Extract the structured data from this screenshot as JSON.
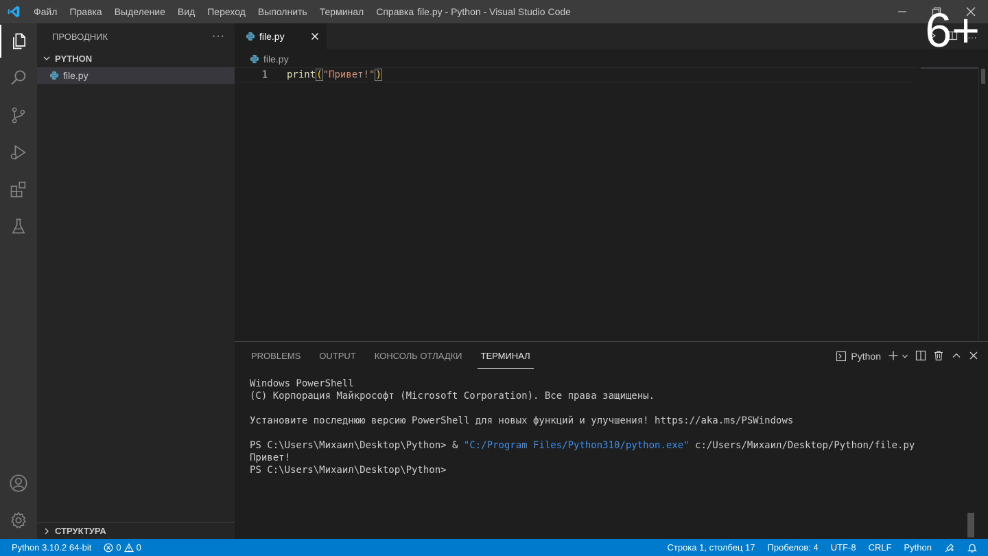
{
  "titlebar": {
    "menu": [
      "Файл",
      "Правка",
      "Выделение",
      "Вид",
      "Переход",
      "Выполнить",
      "Терминал",
      "Справка"
    ],
    "window_title": "file.py - Python - Visual Studio Code"
  },
  "activitybar": {
    "icons": [
      "files-icon",
      "search-icon",
      "source-control-icon",
      "run-debug-icon",
      "extensions-icon",
      "testing-icon",
      "account-icon",
      "settings-gear-icon"
    ]
  },
  "sidebar": {
    "title": "ПРОВОДНИК",
    "more": "···",
    "folder": "PYTHON",
    "file": "file.py",
    "outline": "СТРУКТУРА"
  },
  "editor": {
    "tab_label": "file.py",
    "breadcrumb": "file.py",
    "line_number": "1",
    "code": {
      "fn": "print",
      "open": "(",
      "str": "\"Привет!\"",
      "close": ")"
    }
  },
  "badge": "6+",
  "panel": {
    "tabs": [
      "PROBLEMS",
      "OUTPUT",
      "КОНСОЛЬ ОТЛАДКИ",
      "ТЕРМИНАЛ"
    ],
    "active_tab": "ТЕРМИНАЛ",
    "terminal_label": "Python",
    "terminal_lines": {
      "l1": "Windows PowerShell",
      "l2": "(C) Корпорация Майкрософт (Microsoft Corporation). Все права защищены.",
      "l3": "Установите последнюю версию PowerShell для новых функций и улучшения! https://aka.ms/PSWindows",
      "l4_prompt": "PS C:\\Users\\Михаил\\Desktop\\Python> & ",
      "l4_exe": "\"C:/Program Files/Python310/python.exe\"",
      "l4_arg": " c:/Users/Михаил/Desktop/Python/file.py",
      "l5": "Привет!",
      "l6": "PS C:\\Users\\Михаил\\Desktop\\Python>"
    }
  },
  "statusbar": {
    "interpreter": "Python 3.10.2 64-bit",
    "errors": "0",
    "warnings": "0",
    "position": "Строка 1, столбец 17",
    "spaces": "Пробелов: 4",
    "encoding": "UTF-8",
    "eol": "CRLF",
    "language": "Python"
  },
  "colors": {
    "accent": "#007acc",
    "titlebar": "#3c3c3c",
    "activitybar": "#333333",
    "sidebar": "#252526",
    "editor": "#1e1e1e"
  }
}
